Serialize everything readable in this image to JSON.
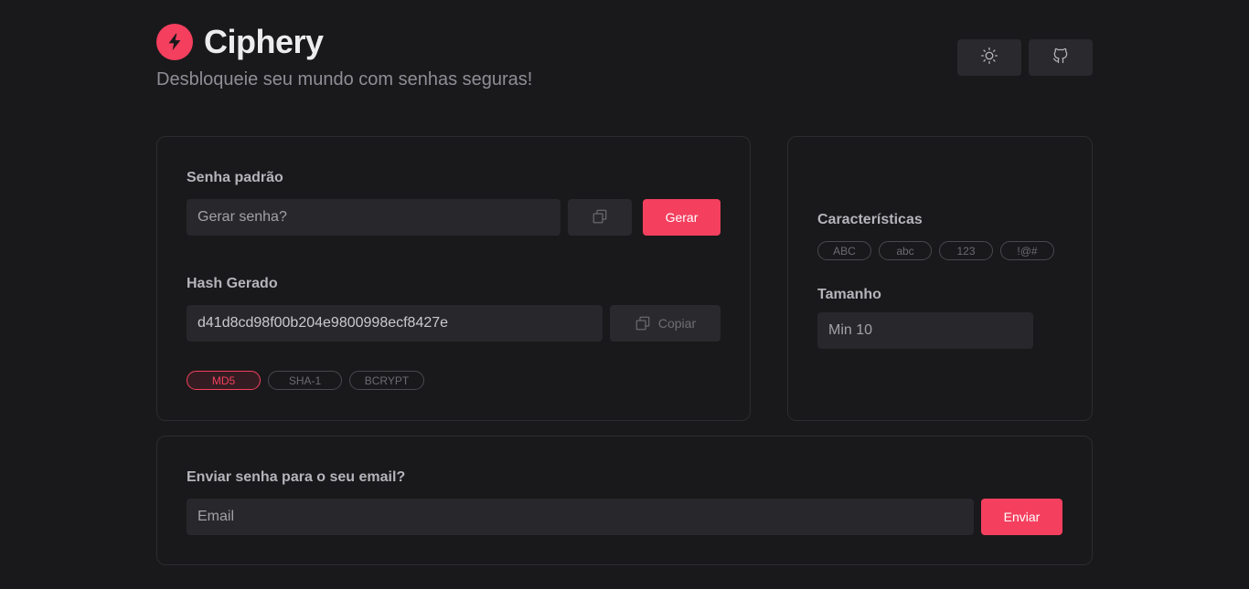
{
  "header": {
    "title": "Ciphery",
    "tagline": "Desbloqueie seu mundo com senhas seguras!",
    "logo_icon": "lightning-bolt-icon",
    "theme_icon": "sun-icon",
    "github_icon": "github-icon"
  },
  "password": {
    "label": "Senha padrão",
    "placeholder": "Gerar senha?",
    "generate_label": "Gerar"
  },
  "hash": {
    "label": "Hash Gerado",
    "value": "d41d8cd98f00b204e9800998ecf8427e",
    "copy_label": "Copiar",
    "algorithms": [
      "MD5",
      "SHA-1",
      "BCRYPT"
    ],
    "selected": "MD5"
  },
  "features": {
    "label": "Características",
    "options": [
      "ABC",
      "abc",
      "123",
      "!@#"
    ]
  },
  "length": {
    "label": "Tamanho",
    "placeholder": "Min 10"
  },
  "email": {
    "label": "Enviar senha para o seu email?",
    "placeholder": "Email",
    "send_label": "Enviar"
  },
  "colors": {
    "background": "#19191b",
    "accent": "#f43f5e",
    "card_border": "#2c2c30",
    "input_bg": "#28282c"
  }
}
